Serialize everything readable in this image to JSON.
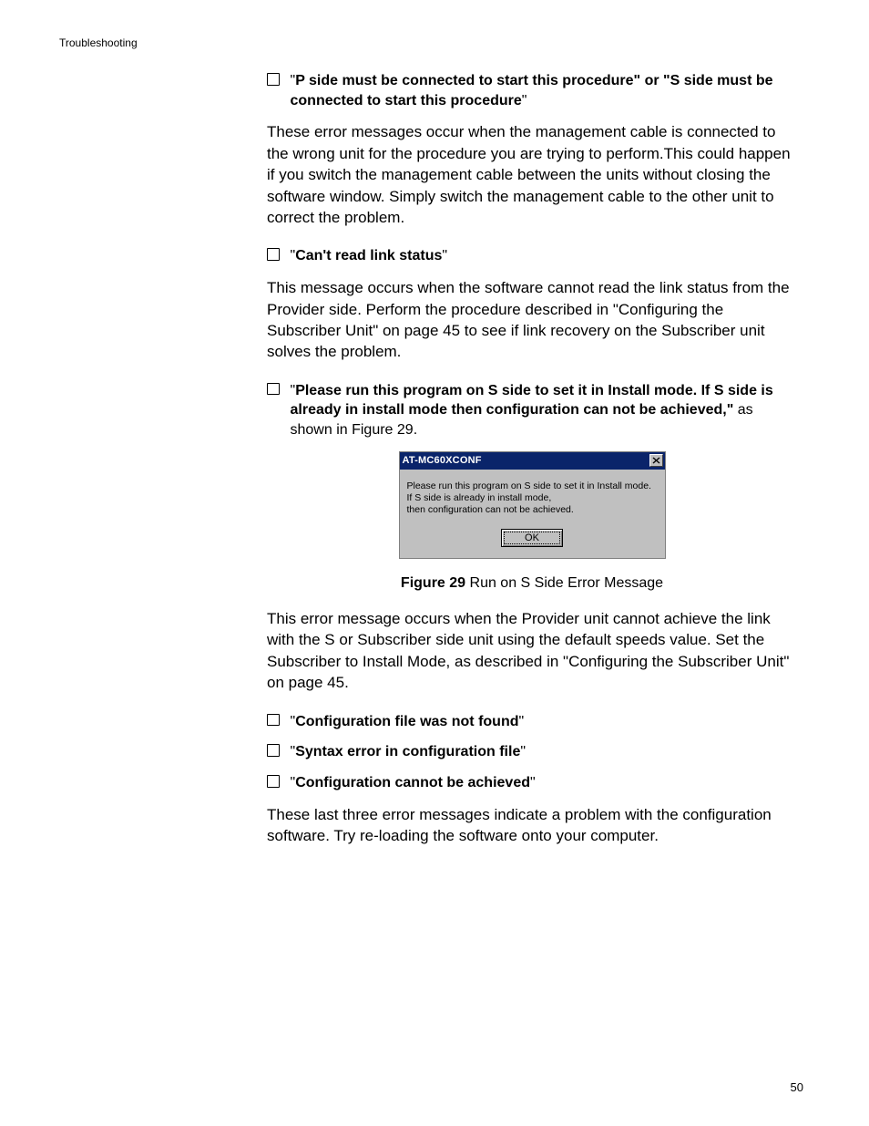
{
  "header": {
    "section": "Troubleshooting"
  },
  "bullets": {
    "b1": {
      "open_q": "\"",
      "bold": "P side must be connected to start this procedure\" or \"S side must be connected to start this procedure",
      "close_q": "\""
    },
    "b2": {
      "open_q": "\"",
      "bold": "Can't read link status",
      "close_q": "\""
    },
    "b3": {
      "open_q": "\"",
      "bold": "Please run this program on S side to set it in Install mode. If S side is already in install mode then configuration can not be achieved,\"",
      "tail": " as shown in Figure 29."
    },
    "b4": {
      "open_q": "\"",
      "bold": "Configuration file was not found",
      "close_q": "\""
    },
    "b5": {
      "open_q": "\"",
      "bold": "Syntax error in configuration file",
      "close_q": "\""
    },
    "b6": {
      "open_q": "\"",
      "bold": "Configuration cannot be achieved",
      "close_q": "\""
    }
  },
  "paras": {
    "p1": "These error messages occur when the management cable is connected to the wrong unit for the procedure you are trying to perform.This could happen if you switch the management cable between the units without closing the software window. Simply switch the management cable to the other unit to correct the problem.",
    "p2": "This message occurs when the software cannot read the link status from the Provider side. Perform the procedure described in \"Configuring the Subscriber Unit\" on page 45 to see if link recovery on the Subscriber unit solves the problem.",
    "p3": "This error message occurs when the Provider unit cannot achieve the link with the S or Subscriber side unit using the default speeds value. Set the Subscriber to Install Mode, as described in \"Configuring the Subscriber Unit\" on page 45.",
    "p4": "These last three error messages indicate a problem with the configuration software. Try re-loading the software onto your computer."
  },
  "dialog": {
    "title": "AT-MC60XCONF",
    "message": "Please run this program on S side to set it in Install mode.\nIf S side is already in install mode,\nthen configuration can not be achieved.",
    "ok": "OK"
  },
  "figure": {
    "label": "Figure 29",
    "caption": "  Run on S Side Error Message"
  },
  "page_number": "50"
}
